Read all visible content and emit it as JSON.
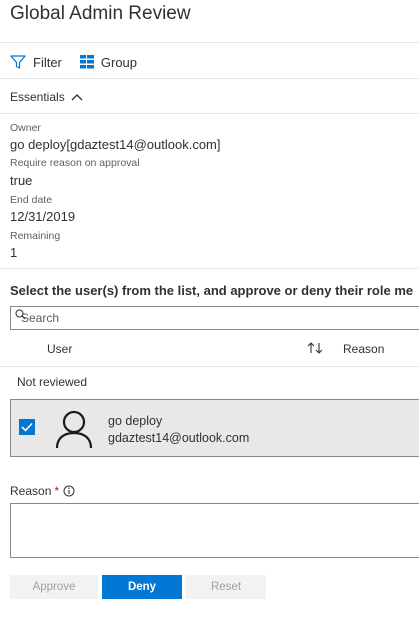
{
  "header": {
    "title": "Global Admin Review"
  },
  "toolbar": {
    "filter_label": "Filter",
    "group_label": "Group"
  },
  "essentials": {
    "label": "Essentials"
  },
  "details": {
    "owner_label": "Owner",
    "owner_value": "go deploy[gdaztest14@outlook.com]",
    "require_reason_label": "Require reason on approval",
    "require_reason_value": "true",
    "end_date_label": "End date",
    "end_date_value": "12/31/2019",
    "remaining_label": "Remaining",
    "remaining_value": "1"
  },
  "review": {
    "instructions": "Select the user(s) from the list, and approve or deny their role me",
    "search_placeholder": "Search",
    "columns": {
      "user": "User",
      "reason": "Reason"
    },
    "group_title": "Not reviewed",
    "rows": [
      {
        "name": "go deploy",
        "email": "gdaztest14@outlook.com",
        "selected": true
      }
    ]
  },
  "reason_field": {
    "label": "Reason",
    "required_marker": "*"
  },
  "actions": {
    "approve_label": "Approve",
    "deny_label": "Deny",
    "reset_label": "Reset"
  },
  "colors": {
    "accent": "#0078d4",
    "row_selected_bg": "#e9e8e7",
    "required": "#a4262c"
  }
}
